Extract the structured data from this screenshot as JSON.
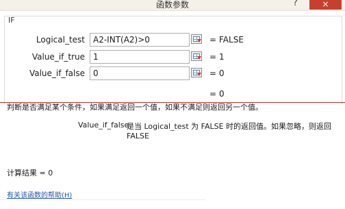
{
  "dialog": {
    "title": "函数参数",
    "help_glyph": "?",
    "close_glyph": "×"
  },
  "function_group": {
    "name": "IF",
    "arguments": [
      {
        "label": "Logical_test",
        "value": "A2-INT(A2)>0",
        "equals": "=",
        "result": "FALSE"
      },
      {
        "label": "Value_if_true",
        "value": "1",
        "equals": "=",
        "result": "1"
      },
      {
        "label": "Value_if_false",
        "value": "0",
        "equals": "=",
        "result": "0"
      }
    ],
    "overall_equals": "=",
    "overall_result": "0"
  },
  "description": {
    "function_text": "判断是否满足某个条件，如果满足返回一个值，如果不满足则返回另一个值。",
    "arg_name": "Value_if_false",
    "arg_text": "是当 Logical_test 为 FALSE 时的返回值。如果忽略，则返回 FALSE"
  },
  "result": {
    "text": "计算结果 =  0"
  },
  "help_link": {
    "text": "有关该函数的帮助(H)"
  },
  "icons": {
    "ref_button": "collapse-dialog-icon"
  },
  "colors": {
    "close_button": "#c7402f",
    "annotation_line": "#c42b2b",
    "link": "#2255aa"
  }
}
